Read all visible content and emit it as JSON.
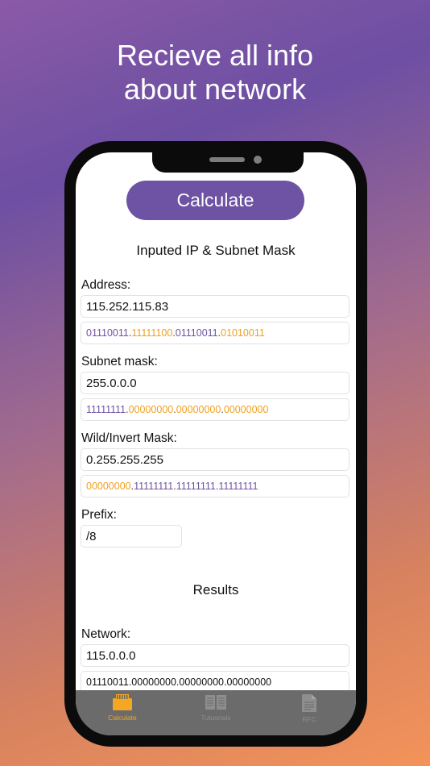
{
  "headline": {
    "line1": "Recieve all info",
    "line2": "about network"
  },
  "calculate_button": "Calculate",
  "input_section": {
    "title": "Inputed IP & Subnet Mask",
    "address": {
      "label": "Address:",
      "value": "115.252.115.83",
      "binary": [
        "01110011",
        "11111100",
        "01110011",
        "01010011"
      ]
    },
    "subnet_mask": {
      "label": "Subnet mask:",
      "value": "255.0.0.0",
      "binary": [
        "11111111",
        "00000000",
        "00000000",
        "00000000"
      ]
    },
    "wild_mask": {
      "label": "Wild/Invert Mask:",
      "value": "0.255.255.255",
      "binary": [
        "00000000",
        "11111111",
        "11111111",
        "11111111"
      ]
    },
    "prefix": {
      "label": "Prefix:",
      "value": "/8"
    }
  },
  "results_section": {
    "title": "Results",
    "network": {
      "label": "Network:",
      "value": "115.0.0.0",
      "binary": "01110011.00000000.00000000.00000000"
    }
  },
  "tabs": [
    {
      "label": "Calculate",
      "icon": "ethernet-port-icon",
      "active": true
    },
    {
      "label": "Tutuorials",
      "icon": "open-book-icon",
      "active": false
    },
    {
      "label": "RFC",
      "icon": "document-icon",
      "active": false
    }
  ],
  "colors": {
    "accent_purple": "#6e52a3",
    "accent_orange": "#f0a020",
    "tab_bar": "#6b6b6b",
    "active_tab": "#f5a623"
  }
}
